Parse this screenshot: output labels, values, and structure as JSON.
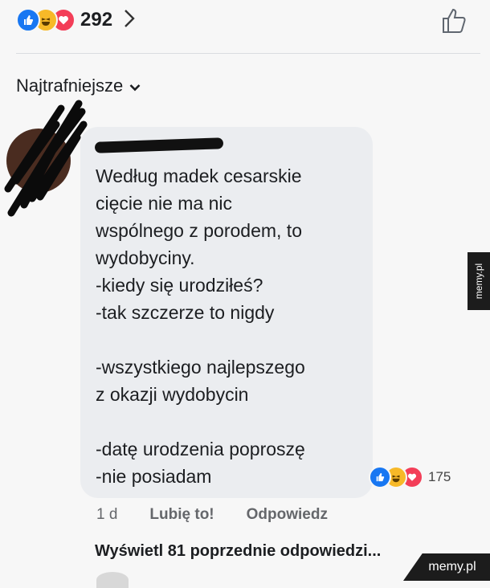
{
  "header": {
    "reactions": [
      "like-icon",
      "haha-icon",
      "love-icon"
    ],
    "reaction_count": "292",
    "colors": {
      "like": "#1877f2",
      "haha": "#f7b928",
      "love": "#f33e58"
    }
  },
  "sort": {
    "label": "Najtrafniejsze"
  },
  "comment": {
    "author": "",
    "text": "Według madek cesarskie\ncięcie nie ma nic\nwspólnego z porodem, to\nwydobyciny.\n-kiedy się urodziłeś?\n-tak szczerze to nigdy\n\n-wszystkiego najlepszego\nz okazji wydobycin\n\n-datę urodzenia poproszę\n-nie posiadam",
    "reaction_count": "175",
    "time": "1 d",
    "like_label": "Lubię to!",
    "reply_label": "Odpowiedz"
  },
  "replies": {
    "view_more_label": "Wyświetl 81 poprzednie odpowiedzi..."
  },
  "watermarks": {
    "side": "memy.pl",
    "corner": "memy.pl"
  }
}
